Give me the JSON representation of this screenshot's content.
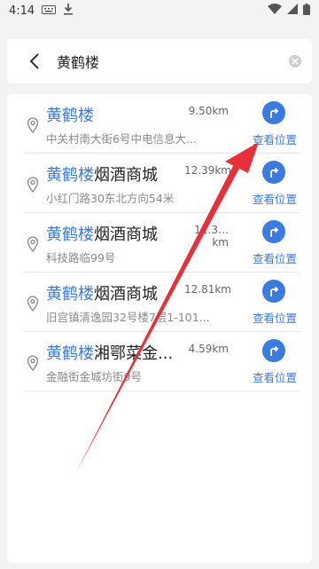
{
  "status": {
    "time": "4:14"
  },
  "search": {
    "query": "黄鹤楼"
  },
  "results": [
    {
      "name_hl": "黄鹤楼",
      "name_rest": "",
      "address": "中关村南大街6号中电信息大...",
      "distance": "9.50km",
      "action": "查看位置"
    },
    {
      "name_hl": "黄鹤楼",
      "name_rest": "烟酒商城",
      "address": "小红门路30东北方向54米",
      "distance": "12.39km",
      "action": "查看位置"
    },
    {
      "name_hl": "黄鹤楼",
      "name_rest": "烟酒商城",
      "address": "科技路临99号",
      "distance": "12.3…km",
      "action": "查看位置"
    },
    {
      "name_hl": "黄鹤楼",
      "name_rest": "烟酒商城",
      "address": "旧宫镇清逸园32号楼7层1-101...",
      "distance": "12.81km",
      "action": "查看位置"
    },
    {
      "name_hl": "黄鹤楼",
      "name_rest": "湘鄂菜金...",
      "address": "金融街金城坊街9号",
      "distance": "4.59km",
      "action": "查看位置"
    }
  ],
  "colors": {
    "accent": "#3a7be0",
    "arrow": "#e8303a"
  },
  "icons": {
    "back": "chevron-left-icon",
    "clear": "clear-icon",
    "pin": "location-pin-icon",
    "nav": "directions-icon"
  }
}
